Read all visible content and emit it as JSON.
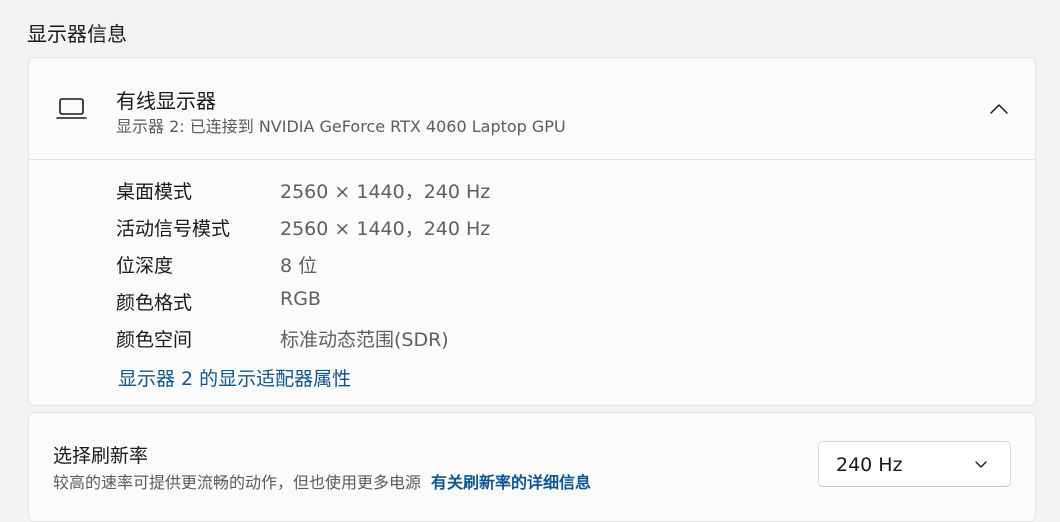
{
  "section": {
    "title": "显示器信息"
  },
  "monitor": {
    "title": "有线显示器",
    "subtitle": "显示器 2: 已连接到 NVIDIA GeForce RTX 4060 Laptop GPU",
    "icon": "laptop-icon",
    "expand_icon": "chevron-up-icon",
    "properties": [
      {
        "label": "桌面模式",
        "value": "2560 × 1440，240 Hz"
      },
      {
        "label": "活动信号模式",
        "value": "2560 × 1440，240 Hz"
      },
      {
        "label": "位深度",
        "value": "8 位"
      },
      {
        "label": "颜色格式",
        "value": "RGB"
      },
      {
        "label": "颜色空间",
        "value": "标准动态范围(SDR)"
      }
    ],
    "adapter_link": "显示器 2 的显示适配器属性"
  },
  "refresh": {
    "title": "选择刷新率",
    "description": "较高的速率可提供更流畅的动作，但也使用更多电源",
    "link": "有关刷新率的详细信息",
    "selected": "240 Hz",
    "dropdown_icon": "chevron-down-icon"
  },
  "colors": {
    "background": "#f3f3f3",
    "card": "#fbfbfb",
    "link": "#0f5694",
    "secondary_text": "#5f5f5f"
  }
}
